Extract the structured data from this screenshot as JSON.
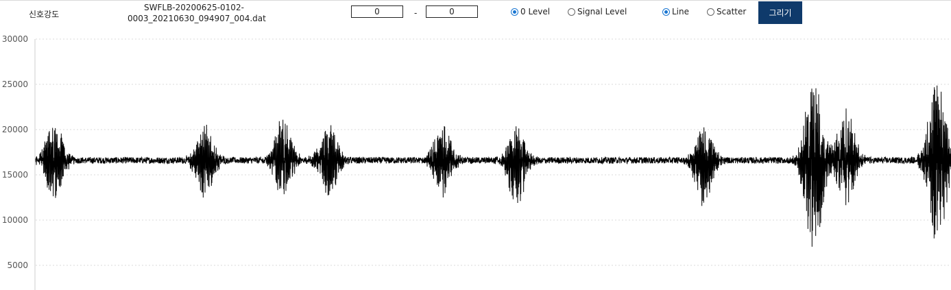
{
  "header": {
    "title": "신호강도",
    "filename_line1": "SWFLB-20200625-0102-",
    "filename_line2": "0003_20210630_094907_004.dat",
    "range_from": "0",
    "range_separator": "-",
    "range_to": "0",
    "level_options": [
      {
        "label": "0 Level",
        "checked": true
      },
      {
        "label": "Signal Level",
        "checked": false
      }
    ],
    "plot_type_options": [
      {
        "label": "Line",
        "checked": true
      },
      {
        "label": "Scatter",
        "checked": false
      }
    ],
    "draw_button": "그리기"
  },
  "chart_data": {
    "type": "line",
    "color": "#000000",
    "title": "",
    "xlabel": "",
    "ylabel": "",
    "ylim": [
      3000,
      30000
    ],
    "yticks": [
      30000,
      25000,
      20000,
      15000,
      10000,
      5000
    ],
    "grid": "horizontal dotted",
    "baseline": 16600,
    "noise_amplitude": 350,
    "bursts": [
      {
        "x": 0.02,
        "max": 21000,
        "min": 12400
      },
      {
        "x": 0.185,
        "max": 20500,
        "min": 12400
      },
      {
        "x": 0.27,
        "max": 21300,
        "min": 12800
      },
      {
        "x": 0.32,
        "max": 20500,
        "min": 12700
      },
      {
        "x": 0.445,
        "max": 20700,
        "min": 12700
      },
      {
        "x": 0.525,
        "max": 20200,
        "min": 11500
      },
      {
        "x": 0.73,
        "max": 20500,
        "min": 11500
      },
      {
        "x": 0.85,
        "max": 26200,
        "min": 5800
      },
      {
        "x": 0.885,
        "max": 22700,
        "min": 11700
      },
      {
        "x": 0.985,
        "max": 26000,
        "min": 6400
      }
    ]
  }
}
